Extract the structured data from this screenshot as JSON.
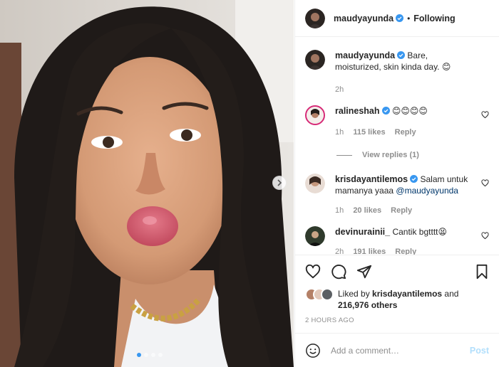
{
  "post": {
    "author": "maudyayunda",
    "follow_status": "Following",
    "caption": "Bare, moisturized, skin kinda day. 😊",
    "caption_age": "2h",
    "carousel": {
      "slide_count": 4,
      "active_slide": 1
    }
  },
  "comments": [
    {
      "user": "ralineshah",
      "verified": true,
      "text": "😊😊😊😊",
      "age": "1h",
      "likes": "115 likes",
      "reply_label": "Reply",
      "view_replies": "View replies (1)"
    },
    {
      "user": "krisdayantilemos",
      "verified": true,
      "text": "Salam untuk mamanya yaaa ",
      "mention": "@maudyayunda",
      "age": "1h",
      "likes": "20 likes",
      "reply_label": "Reply"
    },
    {
      "user": "devinurainii_",
      "verified": false,
      "text": "Cantik bgtttt😫",
      "age": "2h",
      "likes": "191 likes",
      "reply_label": "Reply"
    }
  ],
  "likes": {
    "prefix": "Liked by ",
    "user": "krisdayantilemos",
    "joiner": " and",
    "others": "216,976 others"
  },
  "timestamp": "2 HOURS AGO",
  "add_comment": {
    "placeholder": "Add a comment…",
    "post_label": "Post"
  },
  "colors": {
    "verified": "#3897f0",
    "link": "#00376b",
    "post_disabled": "#b2dffc",
    "muted": "#8e8e8e"
  }
}
